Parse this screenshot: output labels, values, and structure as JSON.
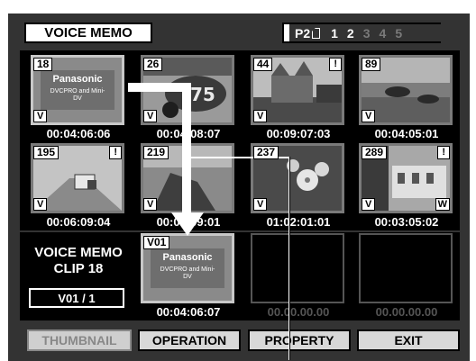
{
  "header": {
    "title": "VOICE MEMO",
    "slot": "P2",
    "pages": [
      "1",
      "2",
      "3",
      "4",
      "5"
    ],
    "active_pages": [
      "1",
      "2"
    ]
  },
  "thumbnails": [
    {
      "clip": "18",
      "timecode": "00:04:06:06",
      "tag": "V",
      "warning": "",
      "selected": true,
      "image": "panasonic-logo",
      "logo": "Panasonic",
      "logo_sub": "DVCPRO and Mini-DV"
    },
    {
      "clip": "26",
      "timecode": "00:04:08:07",
      "tag": "V",
      "warning": "",
      "selected": false,
      "image": "race-car"
    },
    {
      "clip": "44",
      "timecode": "00:09:07:03",
      "tag": "V",
      "warning": "!",
      "selected": false,
      "image": "castle"
    },
    {
      "clip": "89",
      "timecode": "00:04:05:01",
      "tag": "V",
      "warning": "",
      "selected": false,
      "image": "cars-on-road"
    },
    {
      "clip": "195",
      "timecode": "00:06:09:04",
      "tag": "V",
      "warning": "!",
      "selected": false,
      "image": "truck"
    },
    {
      "clip": "219",
      "timecode": "00:04:09:01",
      "tag": "V",
      "warning": "",
      "selected": false,
      "image": "landscape"
    },
    {
      "clip": "237",
      "timecode": "01:02:01:01",
      "tag": "V",
      "warning": "",
      "selected": false,
      "image": "flowers"
    },
    {
      "clip": "289",
      "timecode": "00:03:05:02",
      "tag": "V",
      "tag2": "W",
      "warning": "!",
      "selected": false,
      "image": "building"
    }
  ],
  "voice_memo": {
    "label_line1": "VOICE MEMO",
    "label_line2": "CLIP  18",
    "memo_index": "V01 / 1",
    "memos": [
      {
        "id": "V01",
        "timecode": "00:04:06:07",
        "logo": "Panasonic",
        "logo_sub": "DVCPRO and Mini-DV"
      },
      {
        "timecode": "00.00.00.00"
      },
      {
        "timecode": "00.00.00.00"
      }
    ]
  },
  "buttons": {
    "thumbnail": "THUMBNAIL",
    "operation": "OPERATION",
    "property": "PROPERTY",
    "exit": "EXIT"
  },
  "colors": {
    "background": "#333333",
    "panel": "#000000",
    "button": "#d8d8d8",
    "disabled_text": "#888888"
  }
}
